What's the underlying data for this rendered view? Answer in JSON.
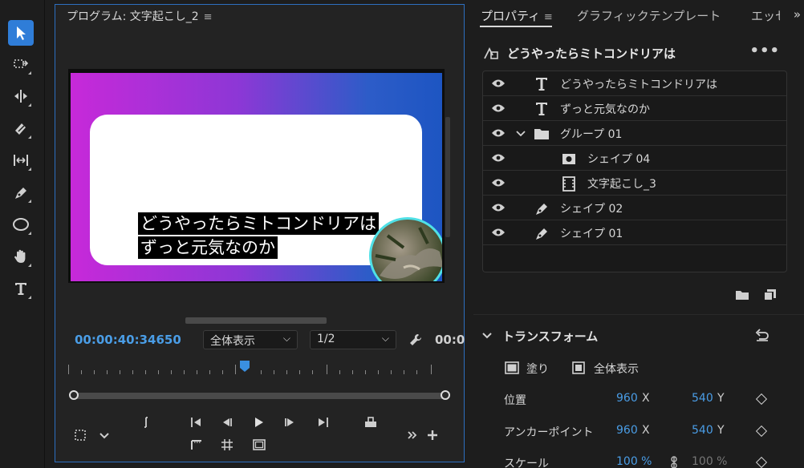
{
  "toolbar": {
    "tools": [
      {
        "icon": "selection-arrow-icon",
        "active": true
      },
      {
        "icon": "track-select-icon"
      },
      {
        "icon": "ripple-edit-icon"
      },
      {
        "icon": "razor-icon"
      },
      {
        "icon": "slip-icon"
      },
      {
        "icon": "pen-icon"
      },
      {
        "icon": "ellipse-icon"
      },
      {
        "icon": "hand-icon"
      },
      {
        "icon": "type-icon"
      }
    ]
  },
  "program": {
    "title": "プログラム: 文字起こし_2",
    "subtitle_line1": "どうやったらミトコンドリアは",
    "subtitle_line2": "ずっと元気なのか",
    "timecode": "00:00:40:34650",
    "zoom_label": "全体表示",
    "resolution_label": "1/2",
    "timecode_right": "00:0"
  },
  "props": {
    "tabs": [
      "プロパティ",
      "グラフィックテンプレート",
      "エッセ"
    ],
    "object_title": "どうやったらミトコンドリアは",
    "layers": [
      {
        "icon": "text-icon",
        "label": "どうやったらミトコンドリアは"
      },
      {
        "icon": "text-icon",
        "label": "ずっと元気なのか"
      },
      {
        "icon": "folder-icon",
        "label": "グループ 01"
      },
      {
        "icon": "shape-icon",
        "label": "シェイプ 04"
      },
      {
        "icon": "clip-icon",
        "label": "文字起こし_3"
      },
      {
        "icon": "pen-icon",
        "label": "シェイプ 02"
      },
      {
        "icon": "pen-icon",
        "label": "シェイプ 01"
      }
    ],
    "section_title": "トランスフォーム",
    "fill_label": "塗り",
    "full_label": "全体表示",
    "position_label": "位置",
    "position_x": "960",
    "position_y": "540",
    "anchor_label": "アンカーポイント",
    "anchor_x": "960",
    "anchor_y": "540",
    "scale_label": "スケール",
    "scale_value": "100 %",
    "scale_value2": "100 %",
    "unit_x": "X",
    "unit_y": "Y"
  }
}
